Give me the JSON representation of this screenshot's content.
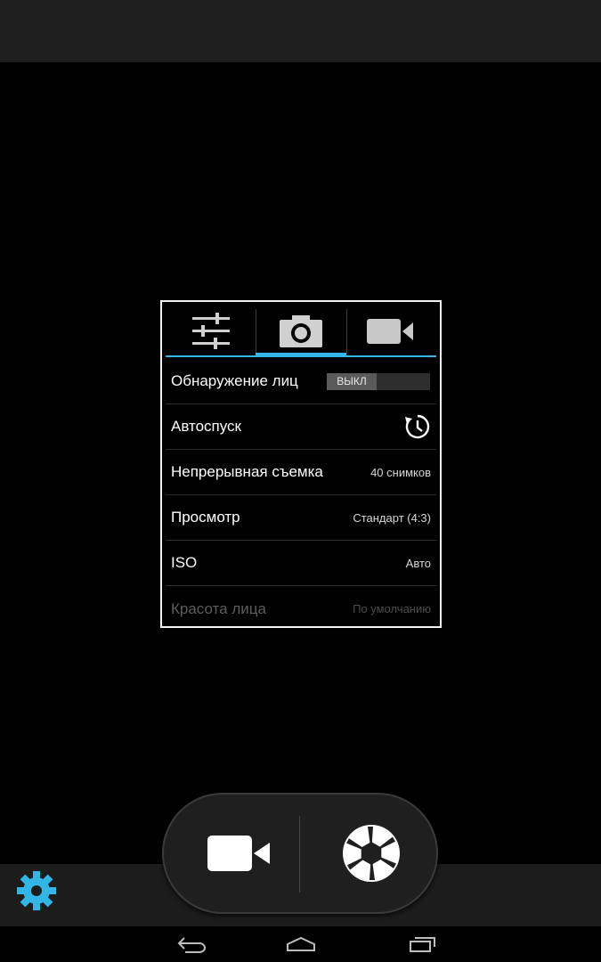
{
  "colors": {
    "accent": "#33b5e5",
    "popup_border": "#f2f2f2",
    "status_bar": "#1e1e1e",
    "control_band": "#1c1c1c"
  },
  "popup": {
    "tabs": [
      {
        "icon": "sliders-icon",
        "active": false
      },
      {
        "icon": "camera-icon",
        "active": true
      },
      {
        "icon": "video-camera-icon",
        "active": false
      }
    ],
    "rows": [
      {
        "label": "Обнаружение лиц",
        "toggle": "ВЫКЛ"
      },
      {
        "label": "Автоспуск",
        "icon": "timer-icon"
      },
      {
        "label": "Непрерывная съемка",
        "value": "40 снимков"
      },
      {
        "label": "Просмотр",
        "value": "Стандарт (4:3)"
      },
      {
        "label": "ISO",
        "value": "Авто"
      },
      {
        "label": "Красота лица",
        "value": "По умолчанию",
        "disabled": true
      }
    ]
  },
  "controls": {
    "settings_icon": "gear-icon",
    "video_icon": "video-camera-icon",
    "shutter_icon": "shutter-icon"
  },
  "nav": {
    "back_icon": "back-icon",
    "home_icon": "home-icon",
    "recents_icon": "recents-icon"
  }
}
